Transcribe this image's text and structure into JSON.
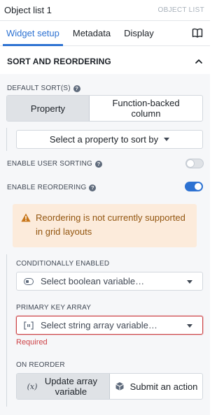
{
  "header": {
    "title": "Object list 1",
    "type_label": "OBJECT LIST"
  },
  "tabs": [
    {
      "label": "Widget setup",
      "active": true
    },
    {
      "label": "Metadata",
      "active": false
    },
    {
      "label": "Display",
      "active": false
    }
  ],
  "section": {
    "title": "SORT AND REORDERING"
  },
  "default_sort": {
    "label": "DEFAULT SORT(S)",
    "options": [
      "Property",
      "Function-backed column"
    ],
    "selected": "Property",
    "select_label": "Select a property to sort by"
  },
  "user_sorting": {
    "label": "ENABLE USER SORTING",
    "enabled": false
  },
  "reordering": {
    "label": "ENABLE REORDERING",
    "enabled": true
  },
  "callout": {
    "text": "Reordering is not currently supported in grid layouts"
  },
  "conditionally_enabled": {
    "label": "CONDITIONALLY ENABLED",
    "placeholder": "Select boolean variable…"
  },
  "primary_key": {
    "label": "PRIMARY KEY ARRAY",
    "placeholder": "Select string array variable…",
    "error": "Required"
  },
  "on_reorder": {
    "label": "ON REORDER",
    "options": [
      "Update array variable",
      "Submit an action"
    ],
    "selected": "Update array variable"
  },
  "colors": {
    "accent": "#2d72d2",
    "warning_bg": "#fcebdb",
    "warning_text": "#935610",
    "danger": "#cd4246"
  }
}
